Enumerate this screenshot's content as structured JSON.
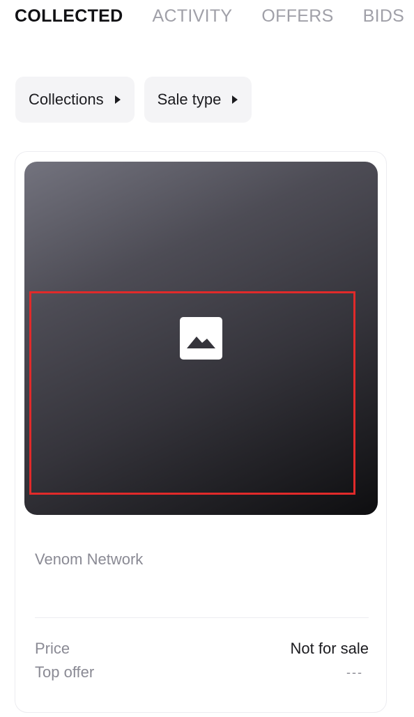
{
  "tabs": [
    {
      "label": "COLLECTED",
      "active": true
    },
    {
      "label": "ACTIVITY",
      "active": false
    },
    {
      "label": "OFFERS",
      "active": false
    },
    {
      "label": "BIDS",
      "active": false
    }
  ],
  "filters": {
    "collections_label": "Collections",
    "sale_type_label": "Sale type"
  },
  "card": {
    "media_icon": "image-placeholder-icon",
    "title": "Venom Network",
    "price_label": "Price",
    "price_value": "Not for sale",
    "top_offer_label": "Top offer",
    "top_offer_value": "---"
  },
  "colors": {
    "highlight": "#e12a2a",
    "text_primary": "#1b1b1f",
    "text_muted": "#8a8a94",
    "filter_bg": "#f4f4f6"
  }
}
